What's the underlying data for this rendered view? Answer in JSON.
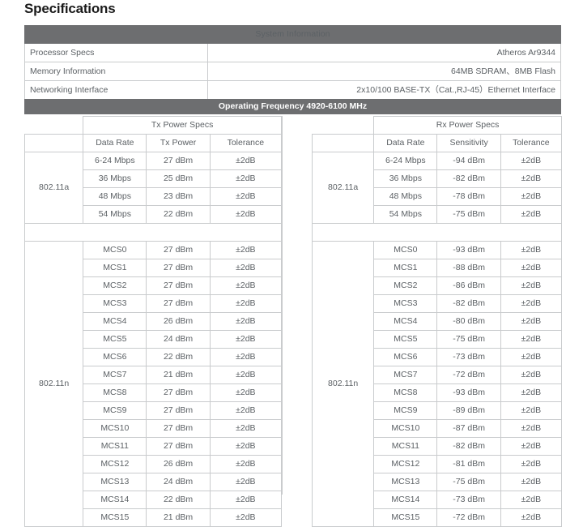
{
  "page": {
    "title": "Specifications"
  },
  "system_information": {
    "header": "System Information",
    "rows": [
      {
        "label": "Processor Specs",
        "value": "Atheros Ar9344"
      },
      {
        "label": "Memory Information",
        "value": "64MB SDRAM、8MB Flash"
      },
      {
        "label": "Networking Interface",
        "value": "2x10/100 BASE-TX（Cat.,RJ-45）Ethernet Interface"
      }
    ]
  },
  "operating_frequency": {
    "header": "Operating Frequency 4920-6100 MHz",
    "tx": {
      "section_title": "Tx Power Specs",
      "columns": [
        "",
        "Data Rate",
        "Tx Power",
        "Tolerance"
      ],
      "groups": [
        {
          "band": "802.11a",
          "rows": [
            {
              "rate": "6-24 Mbps",
              "power": "27 dBm",
              "tolerance": "±2dB"
            },
            {
              "rate": "36 Mbps",
              "power": "25 dBm",
              "tolerance": "±2dB"
            },
            {
              "rate": "48 Mbps",
              "power": "23 dBm",
              "tolerance": "±2dB"
            },
            {
              "rate": "54 Mbps",
              "power": "22 dBm",
              "tolerance": "±2dB"
            }
          ]
        },
        {
          "band": "802.11n",
          "rows": [
            {
              "rate": "MCS0",
              "power": "27 dBm",
              "tolerance": "±2dB"
            },
            {
              "rate": "MCS1",
              "power": "27 dBm",
              "tolerance": "±2dB"
            },
            {
              "rate": "MCS2",
              "power": "27 dBm",
              "tolerance": "±2dB"
            },
            {
              "rate": "MCS3",
              "power": "27 dBm",
              "tolerance": "±2dB"
            },
            {
              "rate": "MCS4",
              "power": "26 dBm",
              "tolerance": "±2dB"
            },
            {
              "rate": "MCS5",
              "power": "24 dBm",
              "tolerance": "±2dB"
            },
            {
              "rate": "MCS6",
              "power": "22 dBm",
              "tolerance": "±2dB"
            },
            {
              "rate": "MCS7",
              "power": "21 dBm",
              "tolerance": "±2dB"
            },
            {
              "rate": "MCS8",
              "power": "27 dBm",
              "tolerance": "±2dB"
            },
            {
              "rate": "MCS9",
              "power": "27 dBm",
              "tolerance": "±2dB"
            },
            {
              "rate": "MCS10",
              "power": "27 dBm",
              "tolerance": "±2dB"
            },
            {
              "rate": "MCS11",
              "power": "27 dBm",
              "tolerance": "±2dB"
            },
            {
              "rate": "MCS12",
              "power": "26 dBm",
              "tolerance": "±2dB"
            },
            {
              "rate": "MCS13",
              "power": "24 dBm",
              "tolerance": "±2dB"
            },
            {
              "rate": "MCS14",
              "power": "22 dBm",
              "tolerance": "±2dB"
            },
            {
              "rate": "MCS15",
              "power": "21 dBm",
              "tolerance": "±2dB"
            }
          ]
        }
      ]
    },
    "rx": {
      "section_title": "Rx Power Specs",
      "columns": [
        "",
        "Data Rate",
        "Sensitivity",
        "Tolerance"
      ],
      "groups": [
        {
          "band": "802.11a",
          "rows": [
            {
              "rate": "6-24 Mbps",
              "sensitivity": "-94 dBm",
              "tolerance": "±2dB"
            },
            {
              "rate": "36 Mbps",
              "sensitivity": "-82 dBm",
              "tolerance": "±2dB"
            },
            {
              "rate": "48 Mbps",
              "sensitivity": "-78 dBm",
              "tolerance": "±2dB"
            },
            {
              "rate": "54 Mbps",
              "sensitivity": "-75 dBm",
              "tolerance": "±2dB"
            }
          ]
        },
        {
          "band": "802.11n",
          "rows": [
            {
              "rate": "MCS0",
              "sensitivity": "-93 dBm",
              "tolerance": "±2dB"
            },
            {
              "rate": "MCS1",
              "sensitivity": "-88 dBm",
              "tolerance": "±2dB"
            },
            {
              "rate": "MCS2",
              "sensitivity": "-86 dBm",
              "tolerance": "±2dB"
            },
            {
              "rate": "MCS3",
              "sensitivity": "-82 dBm",
              "tolerance": "±2dB"
            },
            {
              "rate": "MCS4",
              "sensitivity": "-80 dBm",
              "tolerance": "±2dB"
            },
            {
              "rate": "MCS5",
              "sensitivity": "-75 dBm",
              "tolerance": "±2dB"
            },
            {
              "rate": "MCS6",
              "sensitivity": "-73 dBm",
              "tolerance": "±2dB"
            },
            {
              "rate": "MCS7",
              "sensitivity": "-72 dBm",
              "tolerance": "±2dB"
            },
            {
              "rate": "MCS8",
              "sensitivity": "-93 dBm",
              "tolerance": "±2dB"
            },
            {
              "rate": "MCS9",
              "sensitivity": "-89 dBm",
              "tolerance": "±2dB"
            },
            {
              "rate": "MCS10",
              "sensitivity": "-87 dBm",
              "tolerance": "±2dB"
            },
            {
              "rate": "MCS11",
              "sensitivity": "-82 dBm",
              "tolerance": "±2dB"
            },
            {
              "rate": "MCS12",
              "sensitivity": "-81 dBm",
              "tolerance": "±2dB"
            },
            {
              "rate": "MCS13",
              "sensitivity": "-75 dBm",
              "tolerance": "±2dB"
            },
            {
              "rate": "MCS14",
              "sensitivity": "-73 dBm",
              "tolerance": "±2dB"
            },
            {
              "rate": "MCS15",
              "sensitivity": "-72 dBm",
              "tolerance": "±2dB"
            }
          ]
        }
      ]
    }
  },
  "colors": {
    "header_gray": "#6d6e70",
    "border_gray": "#c9cbcd",
    "text_gray": "#5c6165",
    "title_black": "#1b1b1b"
  }
}
